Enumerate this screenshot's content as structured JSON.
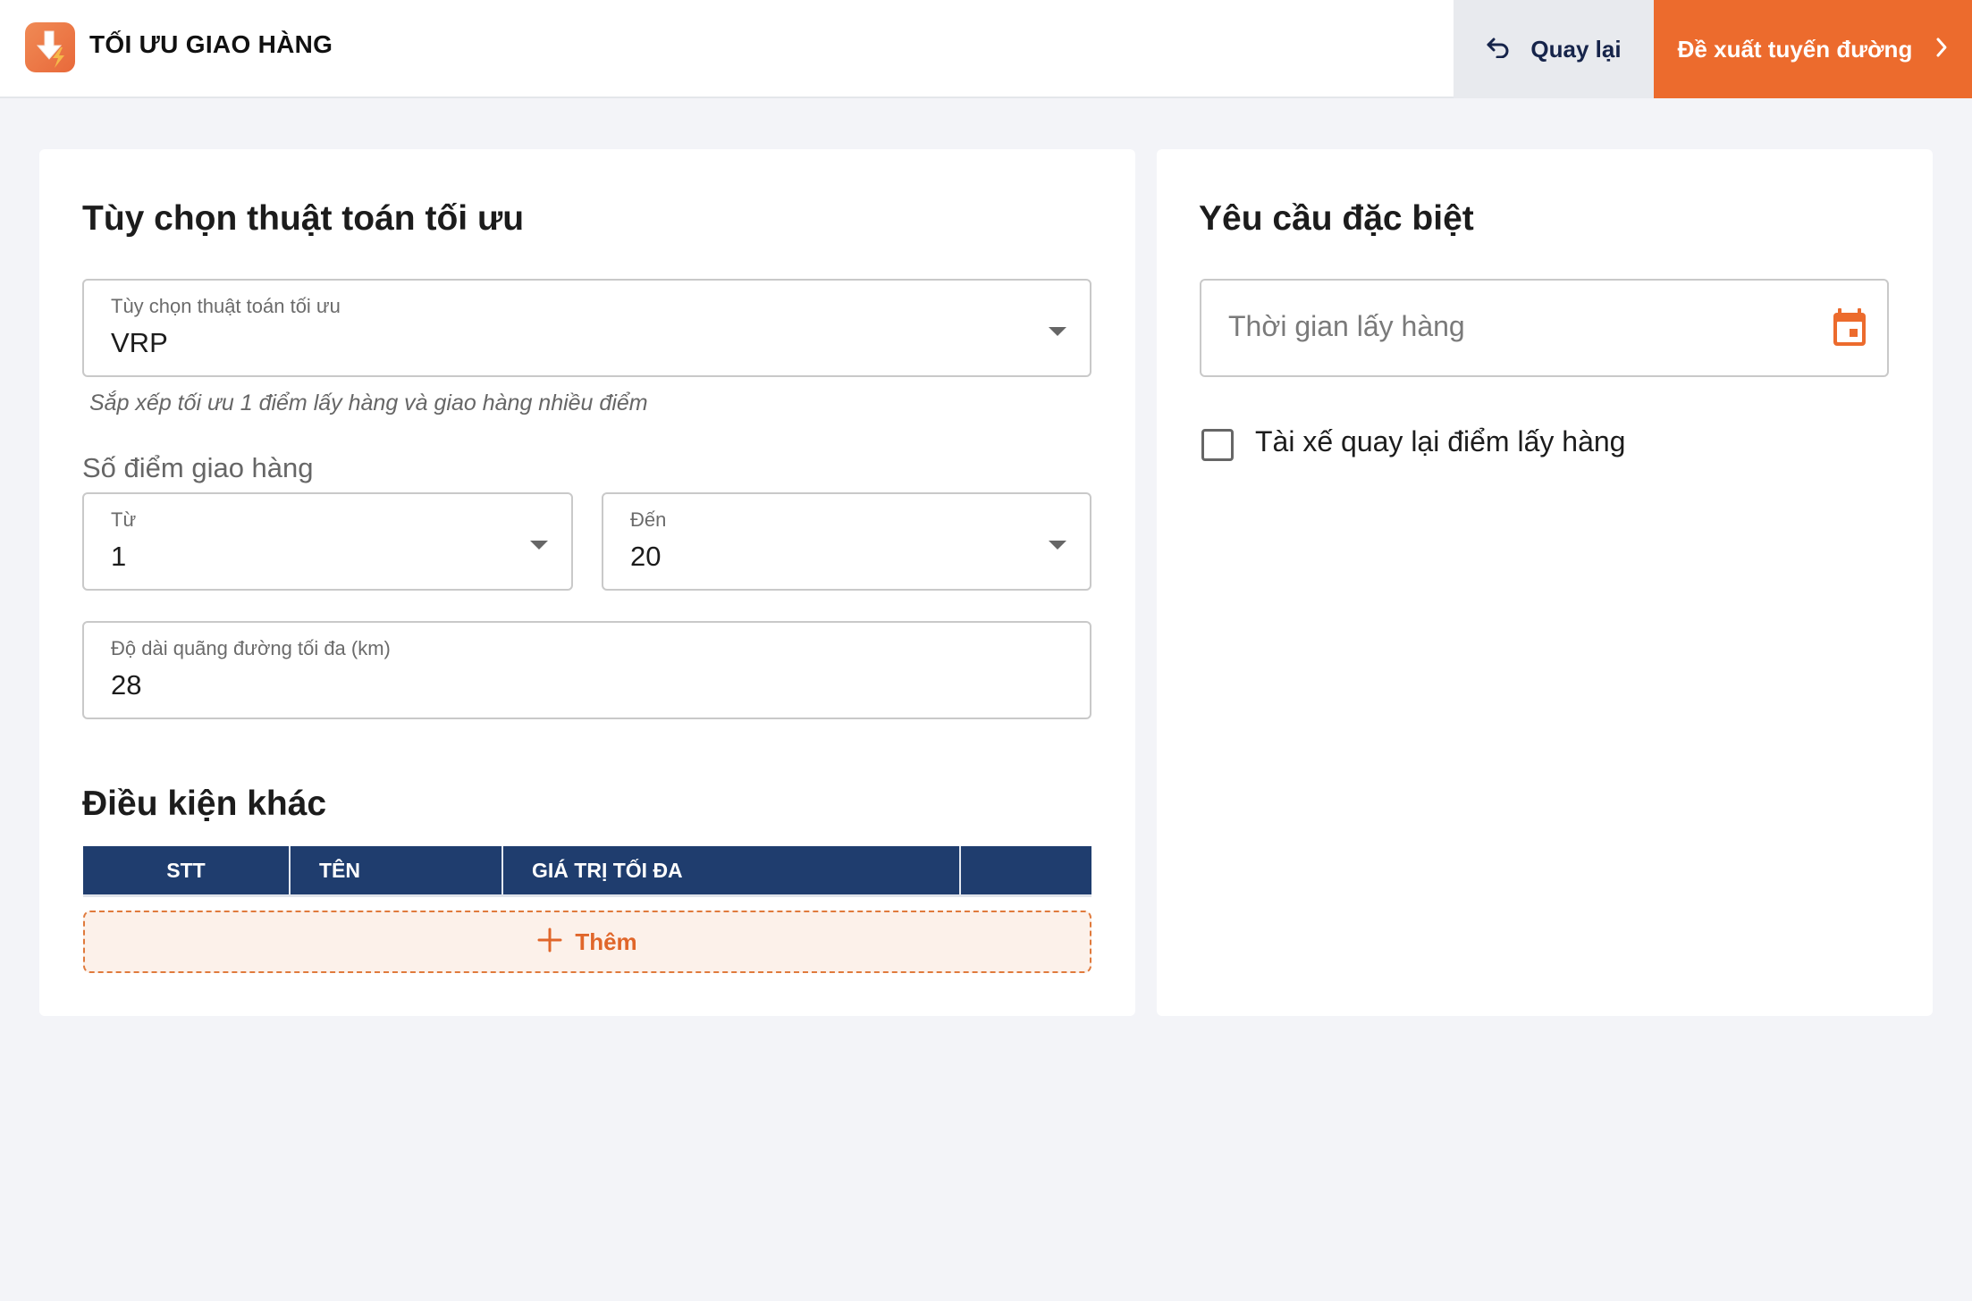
{
  "header": {
    "app_title": "TỐI ƯU GIAO HÀNG",
    "logo_icon": "download-lightning-icon",
    "back_button": {
      "label": "Quay lại",
      "icon": "undo-arrow-icon"
    },
    "next_button": {
      "label": "Đề xuất tuyến đường",
      "icon": "chevron-right-icon"
    }
  },
  "colors": {
    "accent": "#EC6B2D",
    "table_header": "#1F3D6E",
    "back_button_bg": "#E8EAEE",
    "back_button_text": "#16244A",
    "page_bg": "#F3F4F8"
  },
  "algorithm_card": {
    "title": "Tùy chọn thuật toán tối ưu",
    "algorithm_select": {
      "label": "Tùy chọn thuật toán tối ưu",
      "value": "VRP",
      "helper": "Sắp xếp tối ưu 1 điểm lấy hàng và giao hàng nhiều điểm"
    },
    "delivery_points": {
      "label": "Số điểm giao hàng",
      "from": {
        "label": "Từ",
        "value": "1"
      },
      "to": {
        "label": "Đến",
        "value": "20"
      }
    },
    "max_distance": {
      "label": "Độ dài quãng đường tối đa (km)",
      "value": "28"
    },
    "other_conditions": {
      "title": "Điều kiện khác",
      "columns": [
        "STT",
        "TÊN",
        "GIÁ TRỊ TỐI ĐA",
        ""
      ],
      "rows": [],
      "add_label": "Thêm"
    }
  },
  "special_card": {
    "title": "Yêu cầu đặc biệt",
    "pickup_time": {
      "placeholder": "Thời gian lấy hàng",
      "value": "",
      "icon": "calendar-icon"
    },
    "return_to_pickup": {
      "label": "Tài xế quay lại điểm lấy hàng",
      "checked": false
    }
  }
}
